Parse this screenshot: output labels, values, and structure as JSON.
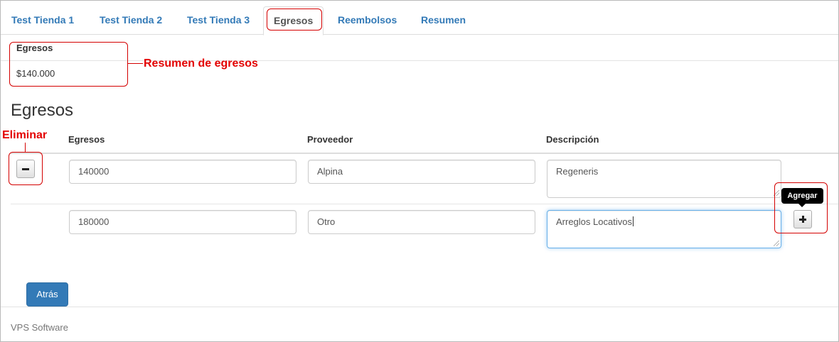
{
  "tabs": [
    {
      "label": "Test Tienda 1"
    },
    {
      "label": "Test Tienda 2"
    },
    {
      "label": "Test Tienda 3"
    },
    {
      "label": "Egresos",
      "active": true
    },
    {
      "label": "Reembolsos"
    },
    {
      "label": "Resumen"
    }
  ],
  "summary": {
    "title": "Egresos",
    "value": "$140.000",
    "annotation": "Resumen de egresos"
  },
  "section": {
    "title": "Egresos",
    "columns": {
      "amount": "Egresos",
      "provider": "Proveedor",
      "description": "Descripción"
    }
  },
  "rows": [
    {
      "amount": "140000",
      "provider": "Alpina",
      "description": "Regeneris"
    },
    {
      "amount": "180000",
      "provider": "Otro",
      "description": "Arreglos Locativos"
    }
  ],
  "annotations": {
    "delete": "Eliminar"
  },
  "add_tooltip": "Agregar",
  "icons": {
    "delete": "minus-icon",
    "add": "plus-icon"
  },
  "back_button": "Atrás",
  "footer": "VPS Software",
  "colors": {
    "link": "#337ab7",
    "primary": "#337ab7",
    "annotation": "#e30000",
    "focus": "#66afe9"
  }
}
